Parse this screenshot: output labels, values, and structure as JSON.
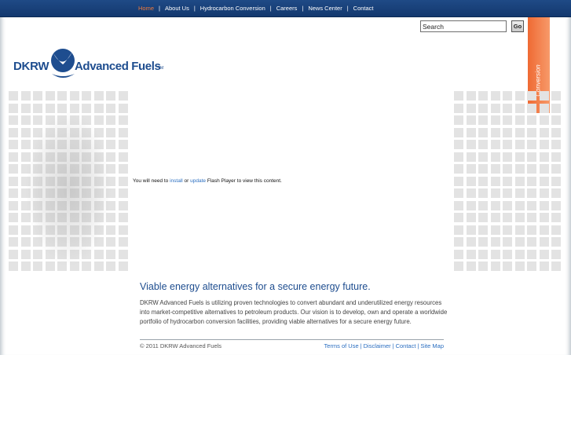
{
  "nav": {
    "items": [
      "Home",
      "About Us",
      "Hydrocarbon Conversion",
      "Careers",
      "News Center",
      "Contact"
    ],
    "separator": "|",
    "active_color": "#f07a3a"
  },
  "search": {
    "value": "Search",
    "button_label": "Go"
  },
  "side_tab": {
    "label": "Conversion",
    "color": "#ef6a33"
  },
  "logo": {
    "left_text": "DKRW",
    "right_text": "Advanced Fuels",
    "tm": "TM",
    "color": "#1e4d8f"
  },
  "flash": {
    "prefix": "You will need to ",
    "install_link": "install",
    "middle": " or ",
    "update_link": "update",
    "suffix": " Flash Player to view this content."
  },
  "main": {
    "headline": "Viable energy alternatives for a secure energy future.",
    "body": "DKRW Advanced Fuels is utilizing proven technologies to convert abundant and underutilized energy resources into market-competitive alternatives to petroleum products. Our vision is to develop, own and operate a worldwide portfolio of hydrocarbon conversion facilities, providing viable alternatives for a secure energy future."
  },
  "footer": {
    "copyright": "© 2011 DKRW Advanced Fuels",
    "links": [
      "Terms of Use",
      "Disclaimer",
      "Contact",
      "Site Map"
    ],
    "separator": "|"
  }
}
